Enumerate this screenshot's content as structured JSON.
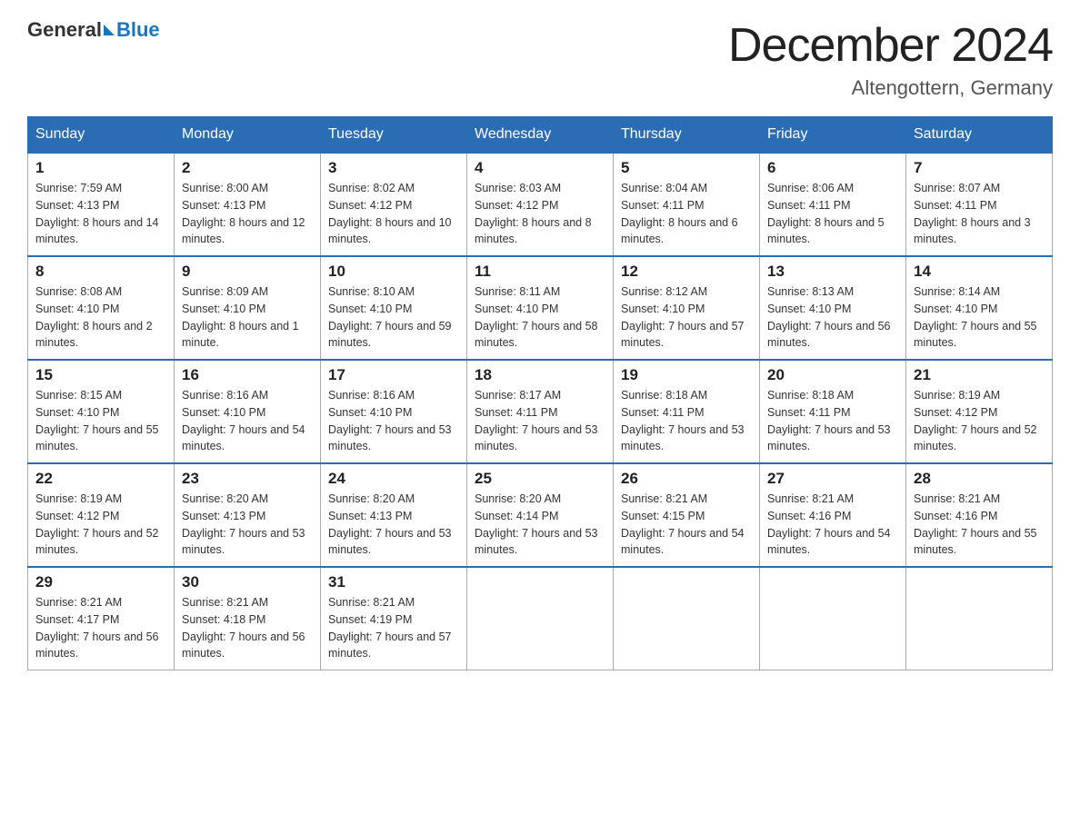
{
  "header": {
    "logo_general": "General",
    "logo_blue": "Blue",
    "month_title": "December 2024",
    "location": "Altengottern, Germany"
  },
  "weekdays": [
    "Sunday",
    "Monday",
    "Tuesday",
    "Wednesday",
    "Thursday",
    "Friday",
    "Saturday"
  ],
  "weeks": [
    [
      {
        "day": "1",
        "sunrise": "7:59 AM",
        "sunset": "4:13 PM",
        "daylight": "8 hours and 14 minutes."
      },
      {
        "day": "2",
        "sunrise": "8:00 AM",
        "sunset": "4:13 PM",
        "daylight": "8 hours and 12 minutes."
      },
      {
        "day": "3",
        "sunrise": "8:02 AM",
        "sunset": "4:12 PM",
        "daylight": "8 hours and 10 minutes."
      },
      {
        "day": "4",
        "sunrise": "8:03 AM",
        "sunset": "4:12 PM",
        "daylight": "8 hours and 8 minutes."
      },
      {
        "day": "5",
        "sunrise": "8:04 AM",
        "sunset": "4:11 PM",
        "daylight": "8 hours and 6 minutes."
      },
      {
        "day": "6",
        "sunrise": "8:06 AM",
        "sunset": "4:11 PM",
        "daylight": "8 hours and 5 minutes."
      },
      {
        "day": "7",
        "sunrise": "8:07 AM",
        "sunset": "4:11 PM",
        "daylight": "8 hours and 3 minutes."
      }
    ],
    [
      {
        "day": "8",
        "sunrise": "8:08 AM",
        "sunset": "4:10 PM",
        "daylight": "8 hours and 2 minutes."
      },
      {
        "day": "9",
        "sunrise": "8:09 AM",
        "sunset": "4:10 PM",
        "daylight": "8 hours and 1 minute."
      },
      {
        "day": "10",
        "sunrise": "8:10 AM",
        "sunset": "4:10 PM",
        "daylight": "7 hours and 59 minutes."
      },
      {
        "day": "11",
        "sunrise": "8:11 AM",
        "sunset": "4:10 PM",
        "daylight": "7 hours and 58 minutes."
      },
      {
        "day": "12",
        "sunrise": "8:12 AM",
        "sunset": "4:10 PM",
        "daylight": "7 hours and 57 minutes."
      },
      {
        "day": "13",
        "sunrise": "8:13 AM",
        "sunset": "4:10 PM",
        "daylight": "7 hours and 56 minutes."
      },
      {
        "day": "14",
        "sunrise": "8:14 AM",
        "sunset": "4:10 PM",
        "daylight": "7 hours and 55 minutes."
      }
    ],
    [
      {
        "day": "15",
        "sunrise": "8:15 AM",
        "sunset": "4:10 PM",
        "daylight": "7 hours and 55 minutes."
      },
      {
        "day": "16",
        "sunrise": "8:16 AM",
        "sunset": "4:10 PM",
        "daylight": "7 hours and 54 minutes."
      },
      {
        "day": "17",
        "sunrise": "8:16 AM",
        "sunset": "4:10 PM",
        "daylight": "7 hours and 53 minutes."
      },
      {
        "day": "18",
        "sunrise": "8:17 AM",
        "sunset": "4:11 PM",
        "daylight": "7 hours and 53 minutes."
      },
      {
        "day": "19",
        "sunrise": "8:18 AM",
        "sunset": "4:11 PM",
        "daylight": "7 hours and 53 minutes."
      },
      {
        "day": "20",
        "sunrise": "8:18 AM",
        "sunset": "4:11 PM",
        "daylight": "7 hours and 53 minutes."
      },
      {
        "day": "21",
        "sunrise": "8:19 AM",
        "sunset": "4:12 PM",
        "daylight": "7 hours and 52 minutes."
      }
    ],
    [
      {
        "day": "22",
        "sunrise": "8:19 AM",
        "sunset": "4:12 PM",
        "daylight": "7 hours and 52 minutes."
      },
      {
        "day": "23",
        "sunrise": "8:20 AM",
        "sunset": "4:13 PM",
        "daylight": "7 hours and 53 minutes."
      },
      {
        "day": "24",
        "sunrise": "8:20 AM",
        "sunset": "4:13 PM",
        "daylight": "7 hours and 53 minutes."
      },
      {
        "day": "25",
        "sunrise": "8:20 AM",
        "sunset": "4:14 PM",
        "daylight": "7 hours and 53 minutes."
      },
      {
        "day": "26",
        "sunrise": "8:21 AM",
        "sunset": "4:15 PM",
        "daylight": "7 hours and 54 minutes."
      },
      {
        "day": "27",
        "sunrise": "8:21 AM",
        "sunset": "4:16 PM",
        "daylight": "7 hours and 54 minutes."
      },
      {
        "day": "28",
        "sunrise": "8:21 AM",
        "sunset": "4:16 PM",
        "daylight": "7 hours and 55 minutes."
      }
    ],
    [
      {
        "day": "29",
        "sunrise": "8:21 AM",
        "sunset": "4:17 PM",
        "daylight": "7 hours and 56 minutes."
      },
      {
        "day": "30",
        "sunrise": "8:21 AM",
        "sunset": "4:18 PM",
        "daylight": "7 hours and 56 minutes."
      },
      {
        "day": "31",
        "sunrise": "8:21 AM",
        "sunset": "4:19 PM",
        "daylight": "7 hours and 57 minutes."
      },
      null,
      null,
      null,
      null
    ]
  ]
}
